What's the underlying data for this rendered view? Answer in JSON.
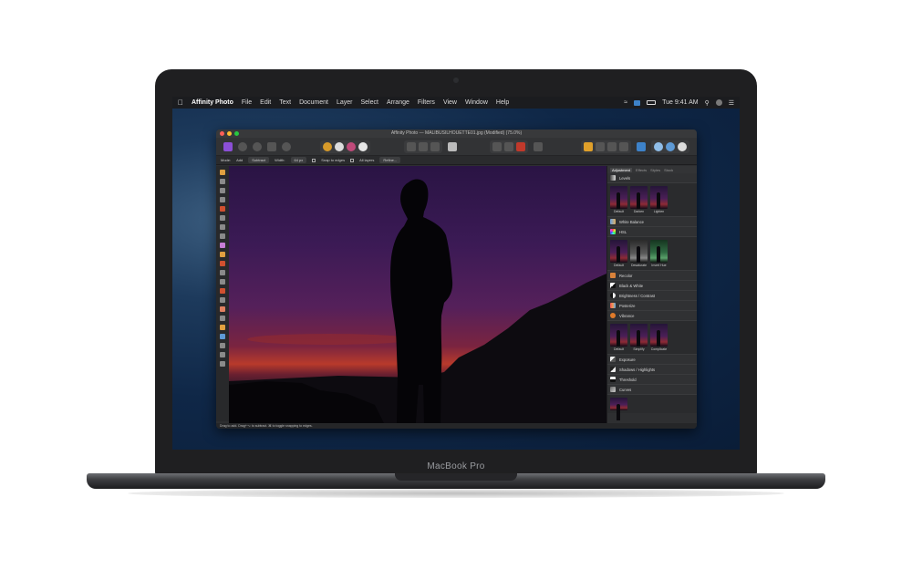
{
  "menubar": {
    "app_name": "Affinity Photo",
    "items": [
      "File",
      "Edit",
      "Text",
      "Document",
      "Layer",
      "Select",
      "Arrange",
      "Filters",
      "View",
      "Window",
      "Help"
    ],
    "clock": "Tue 9:41 AM"
  },
  "window": {
    "title": "Affinity Photo — MALIBUSILHOUETTE01.jpg (Modified) (75.0%)"
  },
  "context_toolbar": {
    "mode_label": "Mode:",
    "add_label": "Add",
    "subtract_label": "Subtract",
    "width_label": "Width:",
    "width_value": "64 px",
    "snap_label": "Snap to edges",
    "all_layers_label": "All layers",
    "refine_label": "Refine..."
  },
  "panel": {
    "tabs": [
      "Adjustment",
      "Effects",
      "Styles",
      "Stock"
    ],
    "levels": "Levels",
    "levels_presets": [
      "Default",
      "Darken",
      "Lighten"
    ],
    "white_balance": "White Balance",
    "hsl": "HSL",
    "hsl_presets": [
      "Default",
      "Desaturate",
      "Invert Hue"
    ],
    "recolor": "Recolor",
    "black_white": "Black & White",
    "brightness_contrast": "Brightness / Contrast",
    "posterize": "Posterize",
    "vibrance": "Vibrance",
    "vibrance_presets": [
      "Default",
      "Simplify",
      "Complicate"
    ],
    "exposure": "Exposure",
    "shadows_highlights": "Shadows / Highlights",
    "threshold": "Threshold",
    "curves": "Curves"
  },
  "statusbar": {
    "hint": "Drag to add. Drag+⌥ to subtract. ⌘ to toggle snapping to edges."
  },
  "device": {
    "label": "MacBook Pro"
  }
}
